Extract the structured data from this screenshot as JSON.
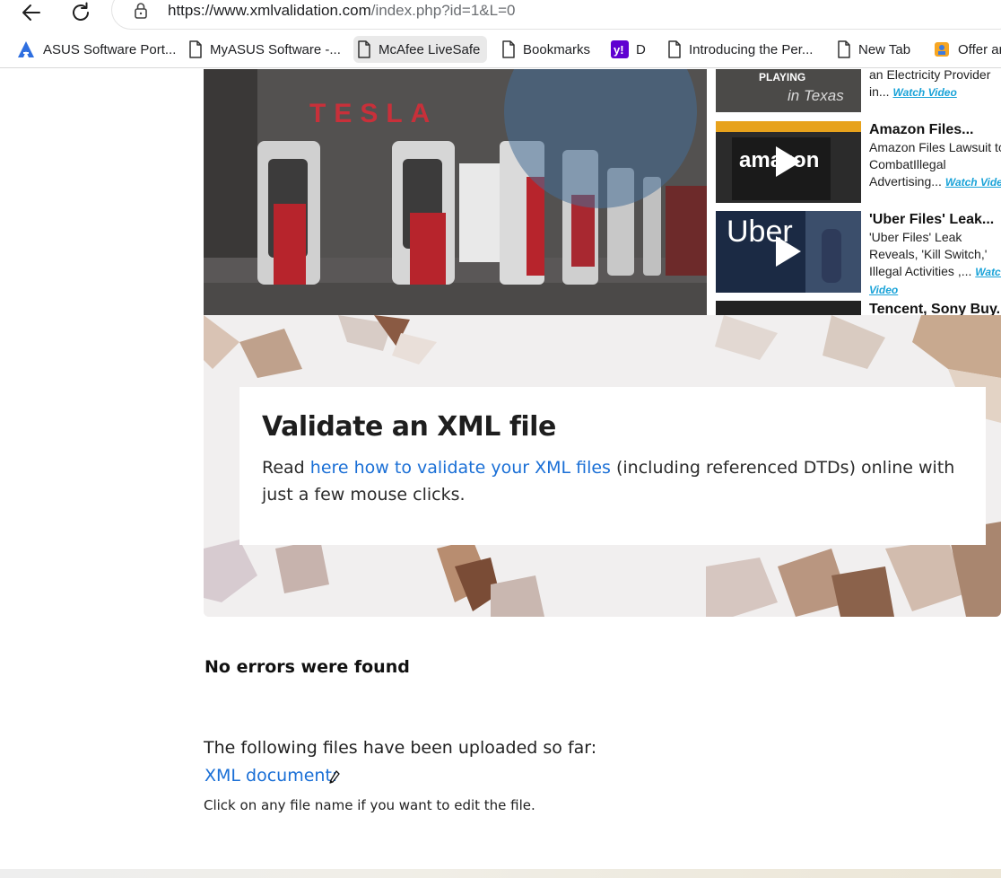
{
  "browser": {
    "url_host": "https://www.xmlvalidation.com",
    "url_path": "/index.php?id=1&L=0",
    "bookmarks": [
      {
        "label": "ASUS Software Port...",
        "icon": "asus-logo-icon"
      },
      {
        "label": "MyASUS Software -...",
        "icon": "page-icon"
      },
      {
        "label": "McAfee LiveSafe",
        "icon": "page-icon"
      },
      {
        "label": "Bookmarks",
        "icon": "page-icon"
      },
      {
        "label": "D",
        "icon": "yahoo-icon"
      },
      {
        "label": "Introducing the Per...",
        "icon": "page-icon"
      },
      {
        "label": "New Tab",
        "icon": "page-icon"
      },
      {
        "label": "Offer ar",
        "icon": "offer-icon"
      }
    ]
  },
  "video_widget": {
    "hero_brand": "TESLA",
    "playing_label": "PLAYING",
    "playing_overlay": "in Texas",
    "items": [
      {
        "title": "",
        "desc": "an Electricity Provider in...",
        "link": "Watch Video",
        "thumb_text": ""
      },
      {
        "title": "Amazon Files...",
        "desc": "Amazon Files Lawsuit to CombatIllegal Advertising...",
        "link": "Watch Video",
        "thumb_text": "amazon"
      },
      {
        "title": "'Uber Files' Leak...",
        "desc": "'Uber Files' Leak Reveals, 'Kill Switch,' Illegal Activities ,...",
        "link": "Watch Video",
        "thumb_text": "Uber"
      },
      {
        "title": "Tencent, Sony Buy...",
        "desc": "",
        "link": "",
        "thumb_text": ""
      }
    ]
  },
  "validate": {
    "heading": "Validate an XML file",
    "text_before": "Read ",
    "link_text": "here how to validate your XML files",
    "text_after": " (including referenced DTDs) online with just a few mouse clicks."
  },
  "result": {
    "status": "No errors were found",
    "uploaded_label": "The following files have been uploaded so far:",
    "file_link": "XML document:",
    "hint": "Click on any file name if you want to edit the file."
  },
  "colors": {
    "link": "#1a6fd6",
    "watch_link": "#1aa3d8",
    "tesla_red": "#c8303a"
  }
}
